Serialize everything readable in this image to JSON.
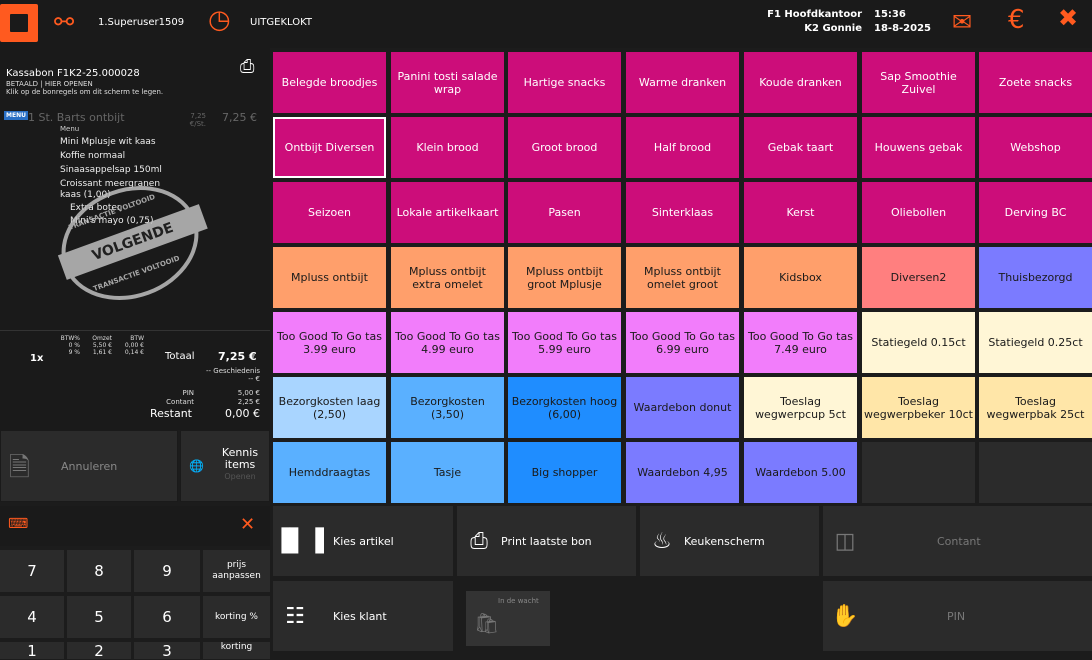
{
  "topbar": {
    "user": "1.Superuser1509",
    "status": "UITGEKLOKT",
    "location_line1": "F1 Hoofdkantoor",
    "location_line2": "K2 Gonnie",
    "time": "15:36",
    "date": "18-8-2025"
  },
  "receipt": {
    "title": "Kassabon F1K2-25.000028",
    "sub1": "BETAALD | HIER OPENEN",
    "sub2": "Klik op de bonregels om dit scherm te legen.",
    "menu_badge": "MENU",
    "item_name": "1 St. Barts ontbijt",
    "item_unit": "7,25",
    "item_unit_label": "€/St.",
    "item_price": "7,25 €",
    "menu_label": "Menu",
    "lines": [
      "Mini Mplusje wit kaas",
      "Koffie normaal",
      "Sinaasappelsap 150ml",
      "Croissant meergranen",
      "kaas (1,00)",
      "Extra boter",
      "Mini's mayo (0,75)"
    ],
    "stamp_text": "VOLGENDE",
    "stamp_ring": "TRANSACTIE VOLTOOID"
  },
  "totals": {
    "qty": "1x",
    "btw_headers": [
      "BTW%",
      "Omzet",
      "BTW"
    ],
    "btw_row1": [
      "0 %",
      "5,50 €",
      "0,00 €"
    ],
    "btw_row2": [
      "9 %",
      "1,61 €",
      "0,14 €"
    ],
    "total_label": "Totaal",
    "total_value": "7,25 €",
    "history_label": "-- Geschiedenis",
    "history_value": "-- €",
    "pin_label": "PIN",
    "pin_value": "5,00 €",
    "contant_label": "Contant",
    "contant_value": "2,25 €",
    "restant_label": "Restant",
    "restant_value": "0,00 €"
  },
  "left_buttons": {
    "annuleren": "Annuleren",
    "kennis_line1": "Kennis",
    "kennis_line2": "items",
    "kennis_sub": "Openen"
  },
  "keypad": {
    "keys": [
      "7",
      "8",
      "9",
      "4",
      "5",
      "6",
      "1",
      "2",
      "3"
    ],
    "prijs": "prijs aanpassen",
    "korting_pct": "korting %",
    "korting": "korting"
  },
  "grid": {
    "rows": [
      [
        "Belegde broodjes",
        "Panini tosti salade wrap",
        "Hartige snacks",
        "Warme dranken",
        "Koude dranken",
        "Sap Smoothie Zuivel",
        "Zoete snacks"
      ],
      [
        "Ontbijt Diversen",
        "Klein brood",
        "Groot brood",
        "Half brood",
        "Gebak taart",
        "Houwens gebak",
        "Webshop"
      ],
      [
        "Seizoen",
        "Lokale artikelkaart",
        "Pasen",
        "Sinterklaas",
        "Kerst",
        "Oliebollen",
        "Derving BC"
      ],
      [
        "Mpluss ontbijt",
        "Mpluss ontbijt extra omelet",
        "Mpluss ontbijt groot Mplusje",
        "Mpluss ontbijt omelet groot",
        "Kidsbox",
        "Diversen2",
        "Thuisbezorgd"
      ],
      [
        "Too Good To Go tas 3.99 euro",
        "Too Good To Go tas 4.99 euro",
        "Too Good To Go tas 5.99 euro",
        "Too Good To Go tas 6.99 euro",
        "Too Good To Go tas 7.49 euro",
        "Statiegeld 0.15ct",
        "Statiegeld 0.25ct"
      ],
      [
        "Bezorgkosten laag (2,50)",
        "Bezorgkosten (3,50)",
        "Bezorgkosten hoog (6,00)",
        "Waardebon donut",
        "Toeslag wegwerpcup 5ct",
        "Toeslag wegwerpbeker 10ct",
        "Toeslag wegwerpbak 25ct"
      ],
      [
        "Hemddraagtas",
        "Tasje",
        "Big shopper",
        "Waardebon 4,95",
        "Waardebon 5.00",
        "",
        ""
      ]
    ]
  },
  "actions": {
    "kies_artikel": "Kies artikel",
    "print": "Print laatste bon",
    "keuken": "Keukenscherm",
    "contant": "Contant",
    "kies_klant": "Kies klant",
    "in_de_wacht": "In de wacht",
    "pin": "PIN"
  }
}
